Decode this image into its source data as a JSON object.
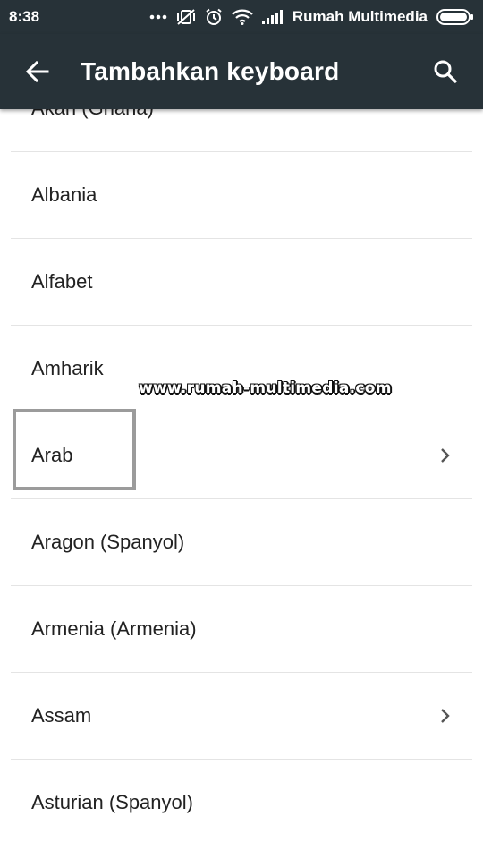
{
  "status_bar": {
    "time": "8:38",
    "carrier": "Rumah Multimedia",
    "icons": [
      "more-dots-icon",
      "vibrate-off-icon",
      "alarm-icon",
      "wifi-icon",
      "signal-icon",
      "battery-icon"
    ]
  },
  "app_bar": {
    "title": "Tambahkan keyboard",
    "back_icon": "arrow-back-icon",
    "search_icon": "search-icon",
    "background": "#273238"
  },
  "languages": [
    {
      "label": "Akan (Ghana)",
      "has_submenu": false
    },
    {
      "label": "Albania",
      "has_submenu": false
    },
    {
      "label": "Alfabet",
      "has_submenu": false
    },
    {
      "label": "Amharik",
      "has_submenu": false
    },
    {
      "label": "Arab",
      "has_submenu": true,
      "highlighted": true
    },
    {
      "label": "Aragon (Spanyol)",
      "has_submenu": false
    },
    {
      "label": "Armenia (Armenia)",
      "has_submenu": false
    },
    {
      "label": "Assam",
      "has_submenu": true
    },
    {
      "label": "Asturian (Spanyol)",
      "has_submenu": false
    }
  ],
  "watermark": "www.rumah-multimedia.com"
}
